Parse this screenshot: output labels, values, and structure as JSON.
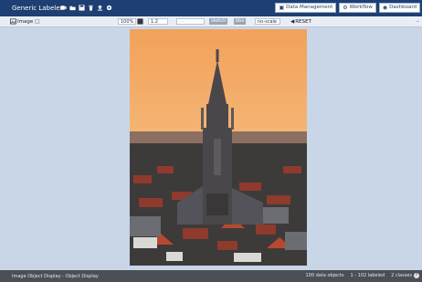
{
  "header": {
    "title": "Generic Labeler",
    "nav": [
      {
        "label": "Data Management",
        "icon": "database-icon"
      },
      {
        "label": "Workflow",
        "icon": "gear-icon"
      },
      {
        "label": "Dashboard",
        "icon": "dashboard-icon"
      }
    ]
  },
  "toolbar": {
    "image_label": "Image",
    "zoom_value": "1.2",
    "select_chip": "sketch",
    "select_chip2": "bbx",
    "resize_value": "no-scale",
    "reset_label": "RESET"
  },
  "status": {
    "left": "Image Object Display - Object Display",
    "objects": "100 data objects",
    "labeled": "1 - 102 labeled",
    "selected": "2 classes"
  }
}
